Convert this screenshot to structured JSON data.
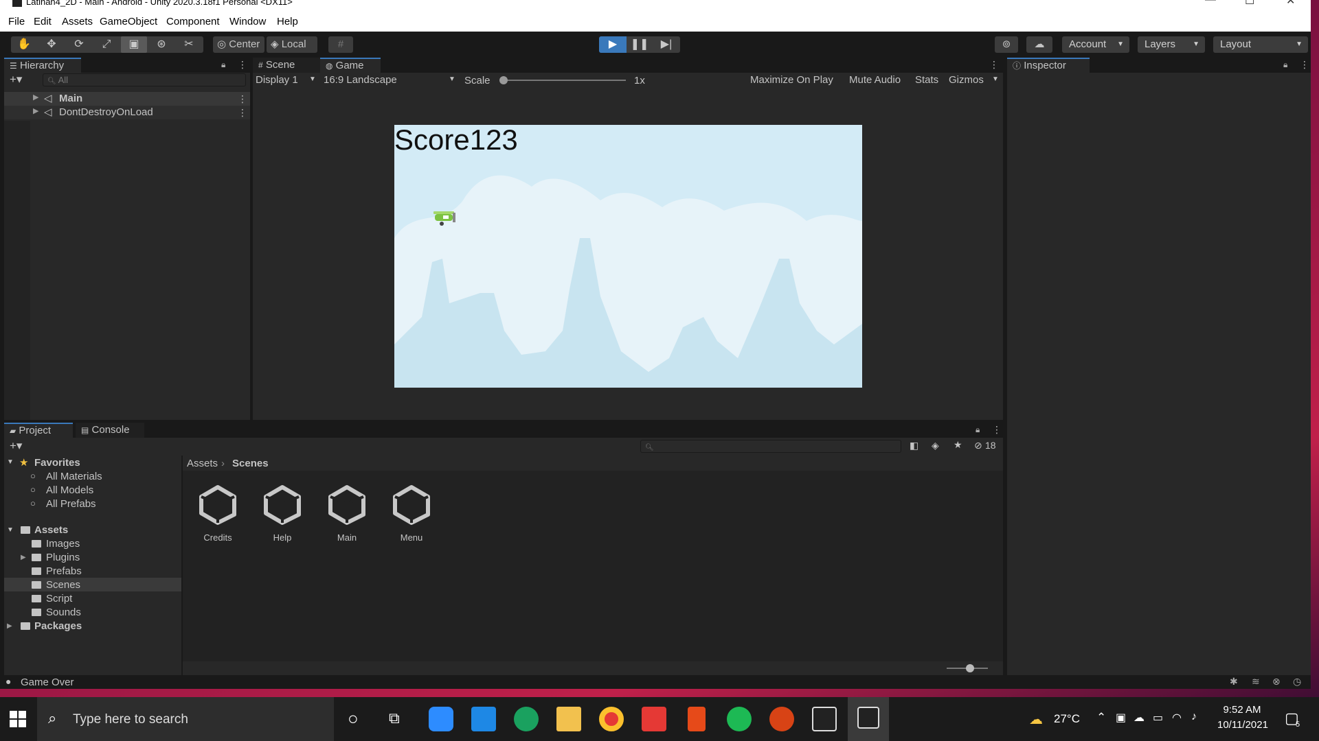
{
  "window": {
    "title": "Latihan4_2D - Main - Android - Unity 2020.3.18f1 Personal <DX11>"
  },
  "menu": [
    "File",
    "Edit",
    "Assets",
    "GameObject",
    "Component",
    "Window",
    "Help"
  ],
  "toolbar": {
    "pivot_label": "Center",
    "space_label": "Local",
    "account_label": "Account",
    "layers_label": "Layers",
    "layout_label": "Layout"
  },
  "hierarchy": {
    "tab_label": "Hierarchy",
    "search_placeholder": "All",
    "items": [
      "Main",
      "DontDestroyOnLoad"
    ]
  },
  "scene_view": {
    "tabs": [
      "Scene",
      "Game"
    ],
    "display": "Display 1",
    "aspect": "16:9 Landscape",
    "scale_label": "Scale",
    "scale_value": "1x",
    "options": [
      "Maximize On Play",
      "Mute Audio",
      "Stats",
      "Gizmos"
    ],
    "score_text": "Score123"
  },
  "inspector": {
    "tab_label": "Inspector"
  },
  "project": {
    "tabs": [
      "Project",
      "Console"
    ],
    "hidden_count": "18",
    "breadcrumb": [
      "Assets",
      "Scenes"
    ],
    "favorites_label": "Favorites",
    "favorites": [
      "All Materials",
      "All Models",
      "All Prefabs"
    ],
    "assets_label": "Assets",
    "asset_folders": [
      "Images",
      "Plugins",
      "Prefabs",
      "Scenes",
      "Script",
      "Sounds"
    ],
    "packages_label": "Packages",
    "scenes": [
      "Credits",
      "Help",
      "Main",
      "Menu"
    ]
  },
  "status": {
    "message": "Game Over"
  },
  "taskbar": {
    "search_placeholder": "Type here to search",
    "weather": "27°C",
    "time": "9:52 AM",
    "date": "10/11/2021",
    "notification_count": "5"
  },
  "colors": {
    "accent": "#3a79bb",
    "sky": "#d3ebf6",
    "plane": "#7cc242"
  }
}
